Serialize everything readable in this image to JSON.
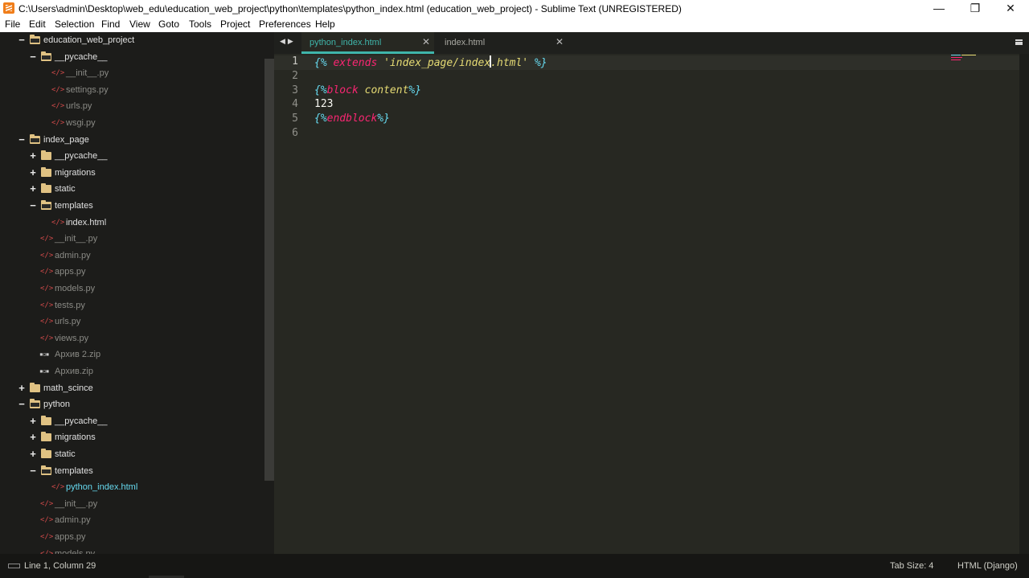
{
  "window": {
    "title": "C:\\Users\\admin\\Desktop\\web_edu\\education_web_project\\python\\templates\\python_index.html (education_web_project) - Sublime Text (UNREGISTERED)",
    "minimize_glyph": "—",
    "maximize_glyph": "❐",
    "close_glyph": "✕"
  },
  "menu": [
    "File",
    "Edit",
    "Selection",
    "Find",
    "View",
    "Goto",
    "Tools",
    "Project",
    "Preferences",
    "Help"
  ],
  "sidebar": {
    "items": [
      {
        "label": "education_web_project",
        "type": "folder",
        "state": "open",
        "depth": 0
      },
      {
        "label": "__pycache__",
        "type": "folder",
        "state": "open",
        "depth": 1
      },
      {
        "label": "__init__.py",
        "type": "file",
        "depth": 2
      },
      {
        "label": "settings.py",
        "type": "file",
        "depth": 2
      },
      {
        "label": "urls.py",
        "type": "file",
        "depth": 2
      },
      {
        "label": "wsgi.py",
        "type": "file",
        "depth": 2
      },
      {
        "label": "index_page",
        "type": "folder",
        "state": "open",
        "depth": 0
      },
      {
        "label": "__pycache__",
        "type": "folder",
        "state": "closed",
        "depth": 1
      },
      {
        "label": "migrations",
        "type": "folder",
        "state": "closed",
        "depth": 1
      },
      {
        "label": "static",
        "type": "folder",
        "state": "closed",
        "depth": 1
      },
      {
        "label": "templates",
        "type": "folder",
        "state": "open",
        "depth": 1
      },
      {
        "label": "index.html",
        "type": "file",
        "depth": 2,
        "bright": true
      },
      {
        "label": "__init__.py",
        "type": "file",
        "depth": 1
      },
      {
        "label": "admin.py",
        "type": "file",
        "depth": 1
      },
      {
        "label": "apps.py",
        "type": "file",
        "depth": 1
      },
      {
        "label": "models.py",
        "type": "file",
        "depth": 1
      },
      {
        "label": "tests.py",
        "type": "file",
        "depth": 1
      },
      {
        "label": "urls.py",
        "type": "file",
        "depth": 1
      },
      {
        "label": "views.py",
        "type": "file",
        "depth": 1
      },
      {
        "label": "Архив 2.zip",
        "type": "zip",
        "depth": 1
      },
      {
        "label": "Архив.zip",
        "type": "zip",
        "depth": 1
      },
      {
        "label": "math_scince",
        "type": "folder",
        "state": "closed",
        "depth": 0
      },
      {
        "label": "python",
        "type": "folder",
        "state": "open",
        "depth": 0
      },
      {
        "label": "__pycache__",
        "type": "folder",
        "state": "closed",
        "depth": 1
      },
      {
        "label": "migrations",
        "type": "folder",
        "state": "closed",
        "depth": 1
      },
      {
        "label": "static",
        "type": "folder",
        "state": "closed",
        "depth": 1
      },
      {
        "label": "templates",
        "type": "folder",
        "state": "open",
        "depth": 1
      },
      {
        "label": "python_index.html",
        "type": "file",
        "depth": 2,
        "selected": true
      },
      {
        "label": "__init__.py",
        "type": "file",
        "depth": 1
      },
      {
        "label": "admin.py",
        "type": "file",
        "depth": 1
      },
      {
        "label": "apps.py",
        "type": "file",
        "depth": 1
      },
      {
        "label": "models.py",
        "type": "file",
        "depth": 1
      }
    ]
  },
  "tabs": [
    {
      "label": "python_index.html",
      "active": true
    },
    {
      "label": "index.html",
      "active": false
    }
  ],
  "editor": {
    "line_numbers": [
      "1",
      "2",
      "3",
      "4",
      "5",
      "6"
    ],
    "current_line": 1,
    "lines": [
      [
        {
          "t": "{% ",
          "c": "tpl"
        },
        {
          "t": "extends ",
          "c": "kw"
        },
        {
          "t": "'index_page/index",
          "c": "str"
        },
        {
          "t": "CURSOR",
          "c": "cursor"
        },
        {
          "t": ".html' ",
          "c": "str"
        },
        {
          "t": "%}",
          "c": "tpl"
        }
      ],
      [],
      [
        {
          "t": "{%",
          "c": "tpl"
        },
        {
          "t": "block ",
          "c": "kw"
        },
        {
          "t": "content",
          "c": "nm"
        },
        {
          "t": "%}",
          "c": "tpl"
        }
      ],
      [
        {
          "t": "123",
          "c": "txt"
        }
      ],
      [
        {
          "t": "{%",
          "c": "tpl"
        },
        {
          "t": "endblock",
          "c": "kw"
        },
        {
          "t": "%}",
          "c": "tpl"
        }
      ],
      []
    ]
  },
  "status": {
    "position": "Line 1, Column 29",
    "tab_size": "Tab Size: 4",
    "syntax": "HTML (Django)"
  },
  "colors": {
    "accent": "#3fb5aa",
    "selected_file": "#66d9ef",
    "bright_file": "#e0e0e0",
    "dim_file": "#8a8a85",
    "folder_text": "#e0e0e0"
  }
}
